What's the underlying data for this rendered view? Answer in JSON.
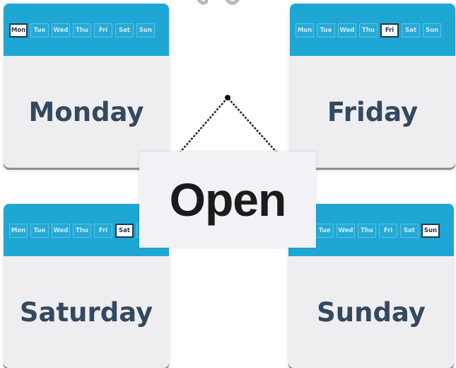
{
  "day_labels": [
    "Mon",
    "Tue",
    "Wed",
    "Thu",
    "Fri",
    "Sat",
    "Sun"
  ],
  "cards": {
    "monday": {
      "title": "Monday",
      "active_day": "Mon"
    },
    "friday": {
      "title": "Friday",
      "active_day": "Fri"
    },
    "saturday": {
      "title": "Saturday",
      "active_day": "Sat"
    },
    "sunday": {
      "title": "Sunday",
      "active_day": "Sun"
    }
  },
  "sign": {
    "text": "Open"
  },
  "colors": {
    "header_blue": "#1ea7d4",
    "card_bg": "#eeeef0",
    "title_text": "#34495f",
    "sign_bg": "#f1f1f6"
  }
}
